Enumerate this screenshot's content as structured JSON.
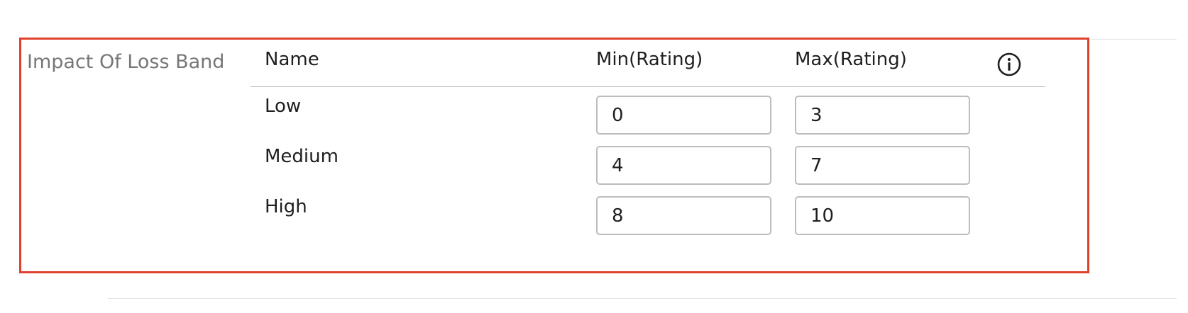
{
  "field": {
    "label": "Impact Of Loss Band"
  },
  "table": {
    "headers": {
      "name": "Name",
      "min": "Min(Rating)",
      "max": "Max(Rating)"
    },
    "info_icon": "info-circle-icon",
    "rows": [
      {
        "name": "Low",
        "min": "0",
        "max": "3"
      },
      {
        "name": "Medium",
        "min": "4",
        "max": "7"
      },
      {
        "name": "High",
        "min": "8",
        "max": "10"
      }
    ]
  },
  "colors": {
    "highlight_border": "#e0412f",
    "label_gray": "#767676",
    "text": "#1f1f1f",
    "input_border": "#bcbcbc"
  }
}
